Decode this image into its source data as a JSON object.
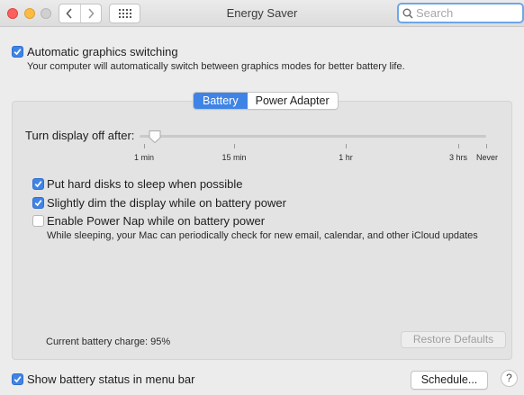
{
  "window": {
    "title": "Energy Saver"
  },
  "toolbar": {
    "back_icon": "chevron-left-icon",
    "forward_icon": "chevron-right-icon",
    "grid_icon": "grid-icon",
    "search_placeholder": "Search"
  },
  "graphics_switching": {
    "label": "Automatic graphics switching",
    "checked": true,
    "description": "Your computer will automatically switch between graphics modes for better battery life."
  },
  "tabs": [
    {
      "label": "Battery",
      "active": true
    },
    {
      "label": "Power Adapter",
      "active": false
    }
  ],
  "display_sleep": {
    "label": "Turn display off after:",
    "value": "2 min",
    "ticks": [
      "1 min",
      "15 min",
      "1 hr",
      "3 hrs",
      "Never"
    ]
  },
  "options": [
    {
      "label": "Put hard disks to sleep when possible",
      "checked": true
    },
    {
      "label": "Slightly dim the display while on battery power",
      "checked": true
    },
    {
      "label": "Enable Power Nap while on battery power",
      "checked": false,
      "description": "While sleeping, your Mac can periodically check for new email, calendar, and other iCloud updates"
    }
  ],
  "battery_charge": "Current battery charge: 95%",
  "restore_defaults_label": "Restore Defaults",
  "show_battery_status": {
    "label": "Show battery status in menu bar",
    "checked": true
  },
  "schedule_label": "Schedule...",
  "help_label": "?",
  "colors": {
    "accent": "#3f84e5",
    "close": "#fc605c",
    "minimize": "#fdbc40"
  }
}
